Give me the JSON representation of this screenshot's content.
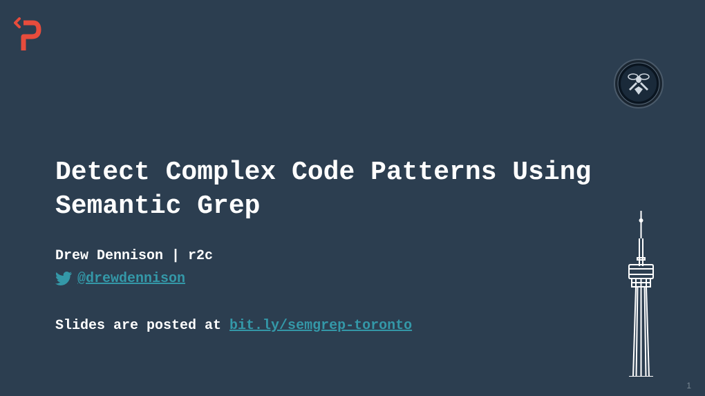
{
  "title": "Detect Complex Code Patterns Using Semantic Grep",
  "author": "Drew Dennison | r2c",
  "twitter_handle": "@drewdennison",
  "slides_text": "Slides are posted at ",
  "slides_link": "bit.ly/semgrep-toronto",
  "page_number": "1",
  "colors": {
    "background": "#2c3e50",
    "accent": "#3498a8",
    "logo": "#e74c3c",
    "text": "#ffffff"
  }
}
